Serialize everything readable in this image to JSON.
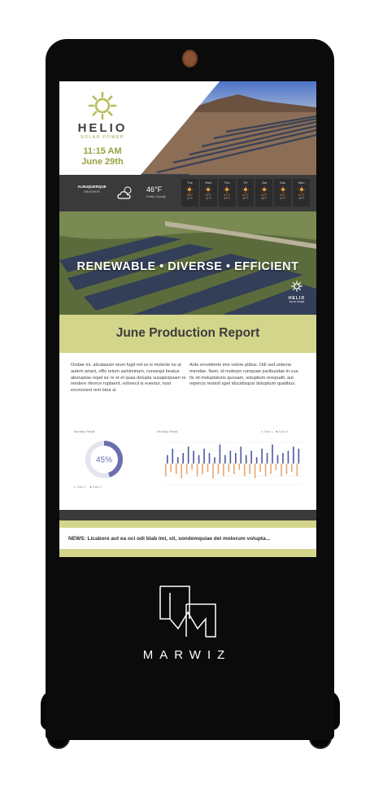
{
  "device": {
    "brand_text": "MARWIZ"
  },
  "header": {
    "brand": "HELIO",
    "brand_sub": "SOLAR POWER",
    "time": "11:15 AM",
    "date": "June 29th"
  },
  "weather": {
    "city": "ALBUQUERQUE",
    "label": "WEATHER",
    "temp": "46°F",
    "condition": "Partly Cloudy",
    "days": [
      {
        "name": "Tue",
        "hi": "58°F",
        "lo": "42°F"
      },
      {
        "name": "Wed",
        "hi": "59°F",
        "lo": "44°F"
      },
      {
        "name": "Thu",
        "hi": "61°F",
        "lo": "45°F"
      },
      {
        "name": "Fri",
        "hi": "60°F",
        "lo": "45°F"
      },
      {
        "name": "Sat",
        "hi": "62°F",
        "lo": "46°F"
      },
      {
        "name": "Sun",
        "hi": "63°F",
        "lo": "47°F"
      },
      {
        "name": "Mon",
        "hi": "61°F",
        "lo": "46°F"
      }
    ]
  },
  "banner": {
    "slogan": "RENEWABLE • DIVERSE • EFFICIENT",
    "logo_name": "HELIO",
    "logo_sub": "SOLAR POWER"
  },
  "report": {
    "title": "June Production Report",
    "col1": "Ondae mi, alicatassin eium fugit mil es is molecte es ut autem ariant, offic tetum asiniminum, consequi beatus aboruptae repel iur re et et quas dolupta susapicipsam re rendere rferece ruptaerit, volorecil is eventur, nost excescieni rem latur si.",
    "col2": "Anto erovidento imo volore plibus. Odi sed untecta mendae. Nam, id molorpo rumquae paribusdae in cus. Ils sit moluptaturis quosam, soluptium rerepudit, aut repercis restiotl apel iducidisquis doluptium quatibus.",
    "chart_left_label": "Monthly Retail",
    "chart_right_label": "Monthly Retail"
  },
  "chart_data": [
    {
      "type": "pie",
      "title": "Monthly Retail",
      "center_label": "45%",
      "values": [
        45,
        55
      ],
      "series": [
        {
          "name": "Sale 1"
        },
        {
          "name": "Sale 2"
        }
      ],
      "colors": [
        "#6a6fb0",
        "#e8a870"
      ]
    },
    {
      "type": "bar",
      "title": "Monthly Retail",
      "series": [
        {
          "name": "Sale 1",
          "color": "#e8a870",
          "values": [
            6,
            4,
            5,
            7,
            5,
            3,
            6,
            5,
            4,
            7,
            5,
            6,
            4,
            5,
            3,
            6,
            5,
            7,
            4,
            6,
            5,
            3,
            6,
            5,
            4,
            6
          ]
        },
        {
          "name": "Sale 2",
          "color": "#4a5aa0",
          "values": [
            4,
            7,
            3,
            5,
            8,
            6,
            4,
            7,
            5,
            3,
            9,
            4,
            6,
            5,
            8,
            4,
            6,
            3,
            7,
            5,
            9,
            4,
            5,
            6,
            8,
            7
          ]
        }
      ],
      "colors": [
        "#e8a870",
        "#4a5aa0"
      ]
    }
  ],
  "news": {
    "text": "NEWS: Licabore aut ea oci odi blab imi, sit, sondemquiae del molorum volupta..."
  },
  "colors": {
    "accent": "#d3d58b",
    "dark_band": "#3a3a3a",
    "kiosk": "#0b0b0b"
  }
}
